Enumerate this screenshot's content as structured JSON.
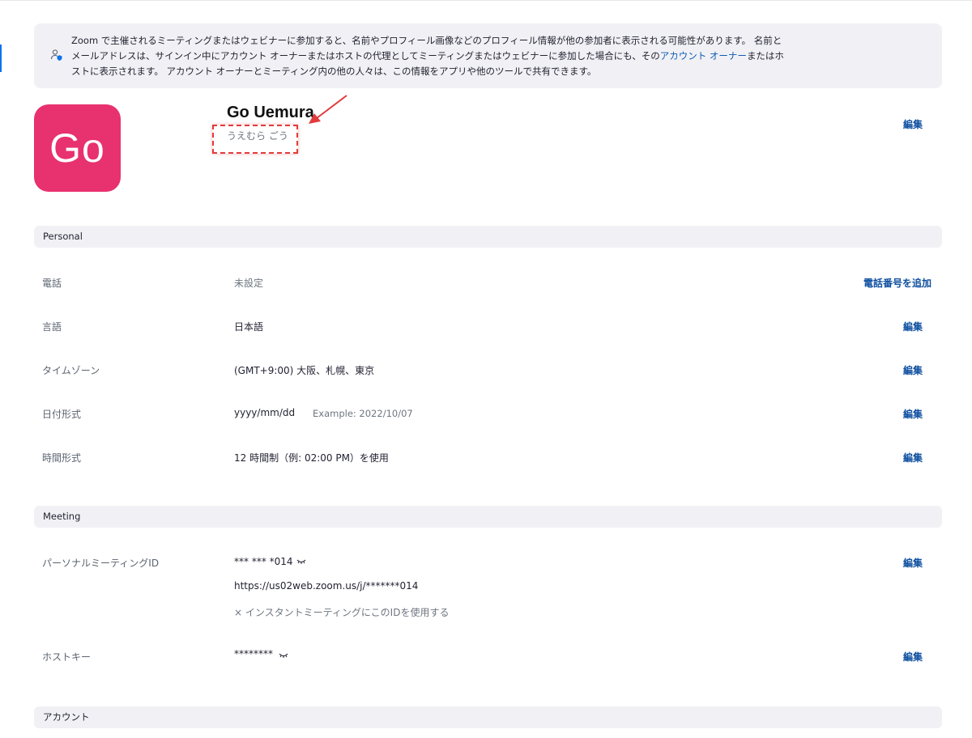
{
  "notice": {
    "icon": "user-shield-icon",
    "line1": "Zoom で主催されるミーティングまたはウェビナーに参加すると、名前やプロフィール画像などのプロフィール情報が他の参加者に表示される可能性があります。 名前と",
    "line2_prefix": "メールアドレスは、サインイン中にアカウント オーナーまたはホストの代理としてミーティングまたはウェビナーに参加した場合にも、その",
    "line2_link": "アカウント オーナー",
    "line2_suffix": "またはホ",
    "line3": "ストに表示されます。 アカウント オーナーとミーティング内の他の人々は、この情報をアプリや他のツールで共有できます。"
  },
  "profile": {
    "avatar_initials": "Go",
    "avatar_color": "#e8316f",
    "name": "Go Uemura",
    "phonetic_name": "うえむら ごう",
    "edit_label": "編集"
  },
  "personal": {
    "header": "Personal",
    "phone": {
      "label": "電話",
      "value": "未設定",
      "action": "電話番号を追加"
    },
    "language": {
      "label": "言語",
      "value": "日本語",
      "action": "編集"
    },
    "timezone": {
      "label": "タイムゾーン",
      "value": "(GMT+9:00) 大阪、札幌、東京",
      "action": "編集"
    },
    "date_format": {
      "label": "日付形式",
      "value": "yyyy/mm/dd",
      "example": "Example: 2022/10/07",
      "action": "編集"
    },
    "time_format": {
      "label": "時間形式",
      "value": "12 時間制（例: 02:00 PM）を使用",
      "action": "編集"
    }
  },
  "meeting": {
    "header": "Meeting",
    "pmi": {
      "label": "パーソナルミーティングID",
      "value": "*** *** *014",
      "url": "https://us02web.zoom.us/j/*******014",
      "instant_option": "× インスタントミーティングにこのIDを使用する",
      "action": "編集"
    },
    "host_key": {
      "label": "ホストキー",
      "value": "********",
      "action": "編集"
    }
  },
  "account": {
    "header": "アカウント"
  },
  "colors": {
    "link": "#0e4fa0",
    "section_bg": "#f1f1f5",
    "annotation": "#e23b3b"
  }
}
